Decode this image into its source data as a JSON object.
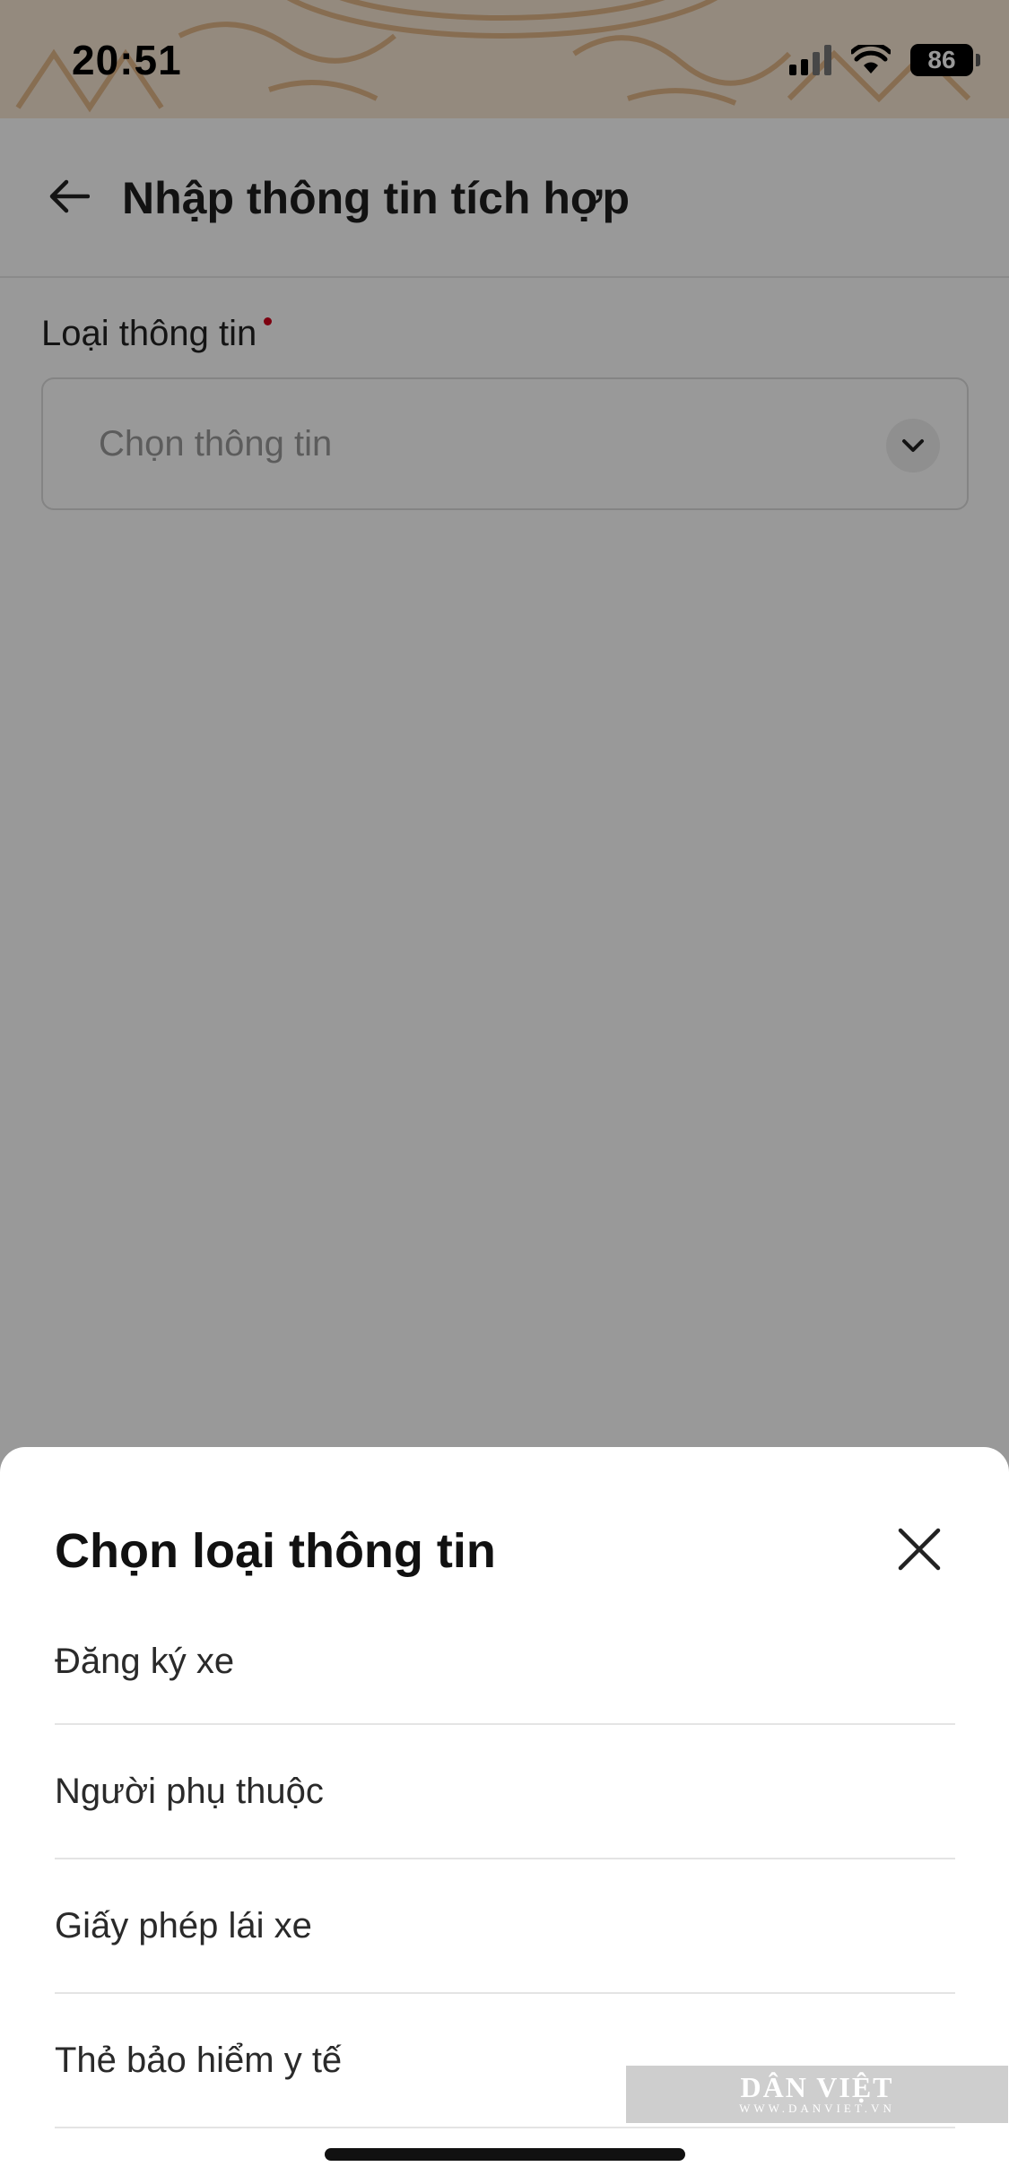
{
  "status_bar": {
    "time": "20:51",
    "battery": "86",
    "icons": [
      "signal-icon",
      "wifi-icon",
      "battery-icon"
    ],
    "pattern_color": "#d9a26a"
  },
  "header": {
    "back_icon": "arrow-left-icon",
    "title": "Nhập thông tin tích hợp"
  },
  "form": {
    "field_label": "Loại thông tin",
    "required_color": "#d0021b",
    "select_placeholder": "Chọn thông tin",
    "select_icon": "chevron-down-icon"
  },
  "bottom_sheet": {
    "title": "Chọn loại thông tin",
    "close_icon": "close-icon",
    "options": [
      {
        "label": "Đăng ký xe"
      },
      {
        "label": "Người phụ thuộc"
      },
      {
        "label": "Giấy phép lái xe"
      },
      {
        "label": "Thẻ bảo hiểm y tế"
      }
    ]
  },
  "watermark": {
    "main": "DÂN VIỆT",
    "sub": "WWW.DANVIET.VN"
  },
  "colors": {
    "overlay": "rgba(0,0,0,0.40)",
    "status_bar_bg": "#f7e6d2",
    "text_primary": "#1f1f1f"
  }
}
